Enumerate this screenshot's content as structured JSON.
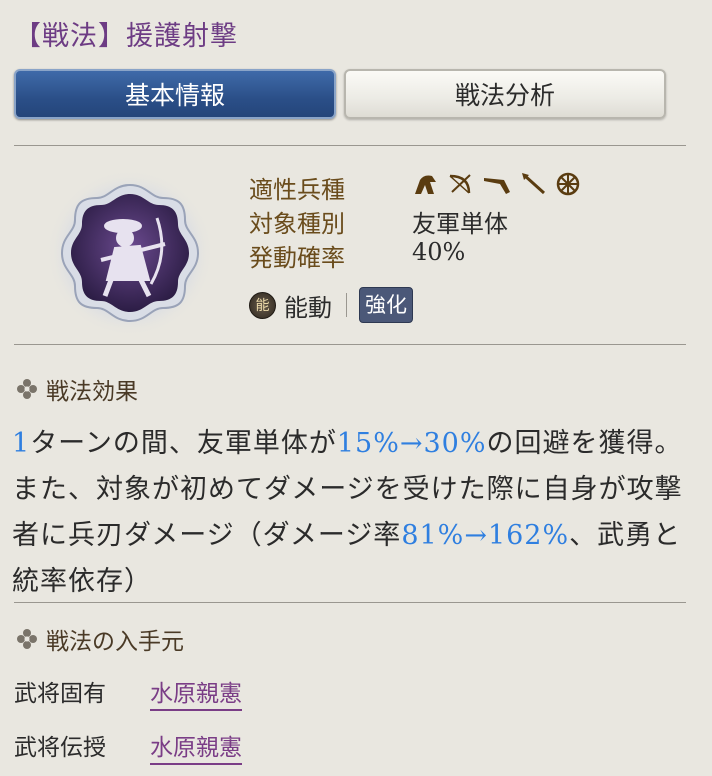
{
  "header": {
    "title": "【戦法】援護射撃"
  },
  "tabs": [
    {
      "label": "基本情報",
      "active": true
    },
    {
      "label": "戦法分析",
      "active": false
    }
  ],
  "info": {
    "unit_type_label": "適性兵種",
    "unit_type_icons": [
      "cavalry-icon",
      "bow-icon",
      "gun-icon",
      "spear-icon",
      "shield-icon"
    ],
    "target_label": "対象種別",
    "target_value": "友軍単体",
    "rate_label": "発動確率",
    "rate_value": "40%",
    "active_mark": "能",
    "active_label": "能動",
    "enhance_badge": "強化"
  },
  "effect": {
    "heading": "戦法効果",
    "p1": "1",
    "p2": "ターンの間、友軍単体が",
    "p3": "15%→30%",
    "p4": "の回避を獲得。また、対象が初めてダメージを受けた際に自身が攻撃者に兵刃ダメージ（ダメージ率",
    "p5": "81%→162%",
    "p6": "、武勇と統率依存）"
  },
  "source": {
    "heading": "戦法の入手元",
    "rows": [
      {
        "label": "武将固有",
        "link": "水原親憲"
      },
      {
        "label": "武将伝授",
        "link": "水原親憲"
      }
    ]
  },
  "colors": {
    "accent_blue": "#2f7fe0",
    "title_purple": "#6d3c84",
    "tab_active": "#2b4f88"
  }
}
